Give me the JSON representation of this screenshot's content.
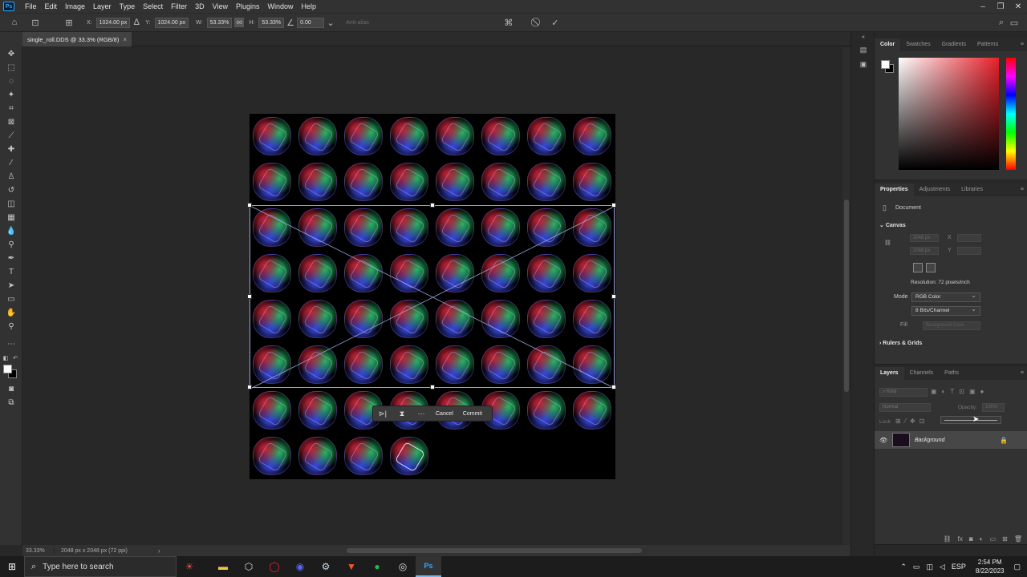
{
  "app": {
    "logo_text": "Ps",
    "menu": [
      "File",
      "Edit",
      "Image",
      "Layer",
      "Type",
      "Select",
      "Filter",
      "3D",
      "View",
      "Plugins",
      "Window",
      "Help"
    ]
  },
  "options": {
    "x_label": "X:",
    "x_value": "1024.00 px",
    "y_label": "Y:",
    "y_value": "1024.00 px",
    "w_label": "W:",
    "w_value": "53.33%",
    "h_label": "H:",
    "h_value": "53.33%",
    "angle_value": "0.00",
    "antialias": "Anti-alias"
  },
  "document": {
    "tab_title": "single_roll.DDS @ 33.3% (RGB/8)",
    "close": "×"
  },
  "context_bar": {
    "cancel": "Cancel",
    "commit": "Commit"
  },
  "status": {
    "zoom": "33.33%",
    "info": "2048 px x 2048 px (72 ppi)"
  },
  "color_panel": {
    "tabs": [
      "Color",
      "Swatches",
      "Gradients",
      "Patterns"
    ],
    "foreground": "#ffffff",
    "background": "#000000"
  },
  "properties_panel": {
    "tabs": [
      "Properties",
      "Adjustments",
      "Libraries"
    ],
    "doc_label": "Document",
    "canvas_section": "Canvas",
    "w_value": "2048 px",
    "h_value": "2048 px",
    "x_label": "X",
    "y_label": "Y",
    "resolution": "Resolution: 72 pixels/inch",
    "mode_label": "Mode",
    "mode_value": "RGB Color",
    "bits_value": "8 Bits/Channel",
    "fill_label": "Fill",
    "fill_value": "Background Color",
    "rulers_section": "Rulers & Grids"
  },
  "layers_panel": {
    "tabs": [
      "Layers",
      "Channels",
      "Paths"
    ],
    "search_placeholder": "Kind",
    "blend_mode": "Normal",
    "opacity_label": "Opacity:",
    "opacity_value": "100%",
    "lock_label": "Lock:",
    "fill_label": "Fill:",
    "layer_name": "Background"
  },
  "taskbar": {
    "search_placeholder": "Type here to search",
    "lang": "ESP",
    "time": "2:54 PM",
    "date": "8/22/2023"
  }
}
